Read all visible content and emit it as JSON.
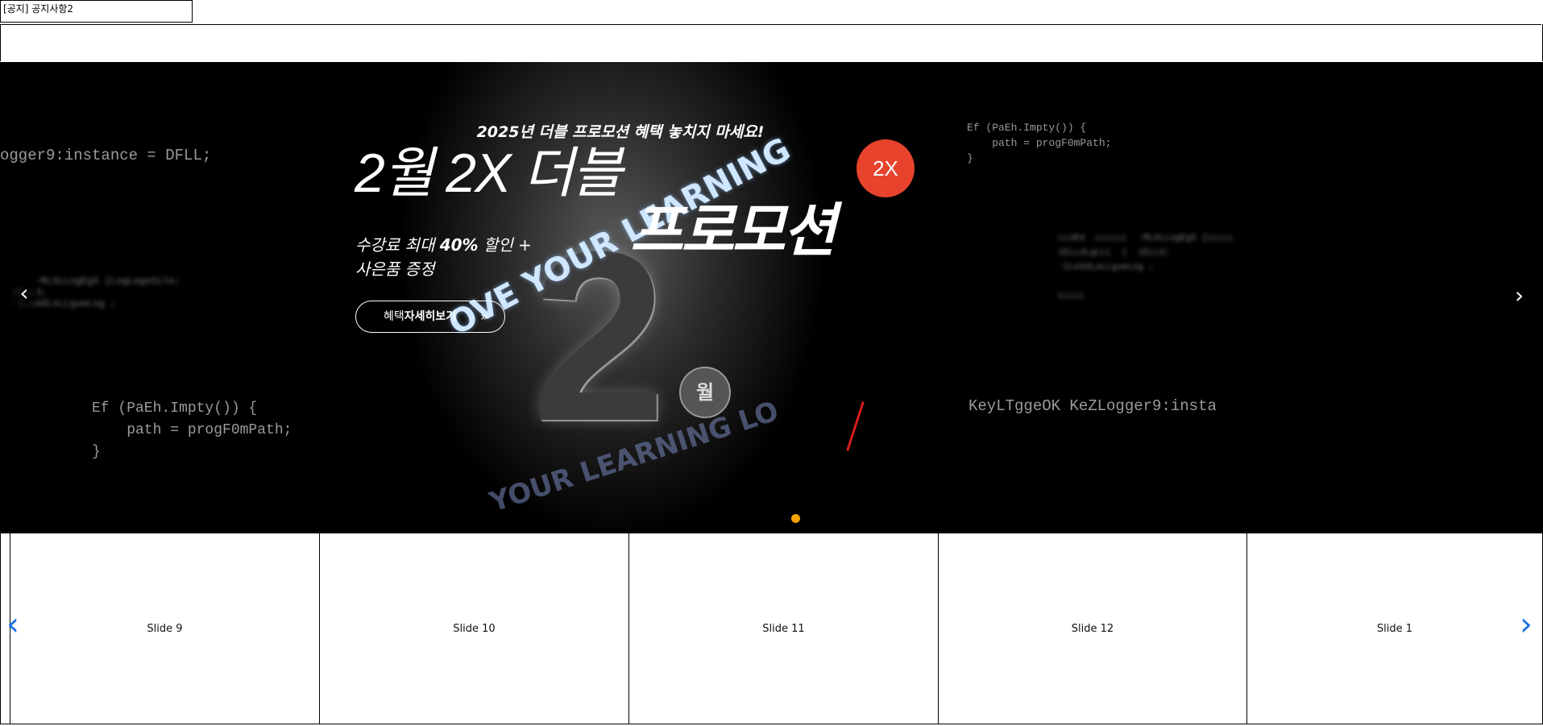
{
  "notice": {
    "text": "[공지] 공지사항2"
  },
  "hero": {
    "code_left_top": "ogger9:instance = DFLL;",
    "code_left_blur1": "      ·MLSLLogEgS {LogLegeSile;\n  iELLd;\n  ·ILeSdLoLLgueLog ;",
    "code_left_bottom": "Ef (PaEh.Impty()) {\n    path = progF0mPath;\n}",
    "code_right_top": "Ef (PaEh.Impty()) {\n    path = progF0mPath;\n}",
    "code_right_blur": "  LLoEd  LLLLLL  ·MLSLLogEgS {LLLLL\n  iELLdLgLLL  {  iELLd;\n  ·ILeSdLoLLgueLog ;\n\n  LLLLL",
    "code_right_bottom": "KeyLTggeOK KeZLogger9:insta",
    "promo_top": "2025년 더블 프로모션 혜택 놓치지 마세요!",
    "promo_title": "2월 2X 더블",
    "promo_big": "프로모션",
    "badge": "2X",
    "desc_line1_pre": "수강료 최대 ",
    "desc_line1_bold": "40%",
    "desc_line1_post": " 할인 +",
    "desc_line2": "사은품 증정",
    "button_pre": "혜택",
    "button_bold": "자세히보기",
    "button_arrows": "»",
    "big_number": "2",
    "ribbon_text": "OVE YOUR LEARNING",
    "ribbon_back": "YOUR LEARNING LO",
    "month": "월",
    "prev_icon": "‹",
    "next_icon": "›"
  },
  "carousel": {
    "slides": [
      "Slide 9",
      "Slide 10",
      "Slide 11",
      "Slide 12",
      "Slide 1"
    ],
    "prev_icon": "‹",
    "next_icon": "›"
  },
  "colors": {
    "accent_dot": "#f3a200",
    "arrow_blue": "#1a73e8",
    "badge_red": "#e8432c"
  }
}
